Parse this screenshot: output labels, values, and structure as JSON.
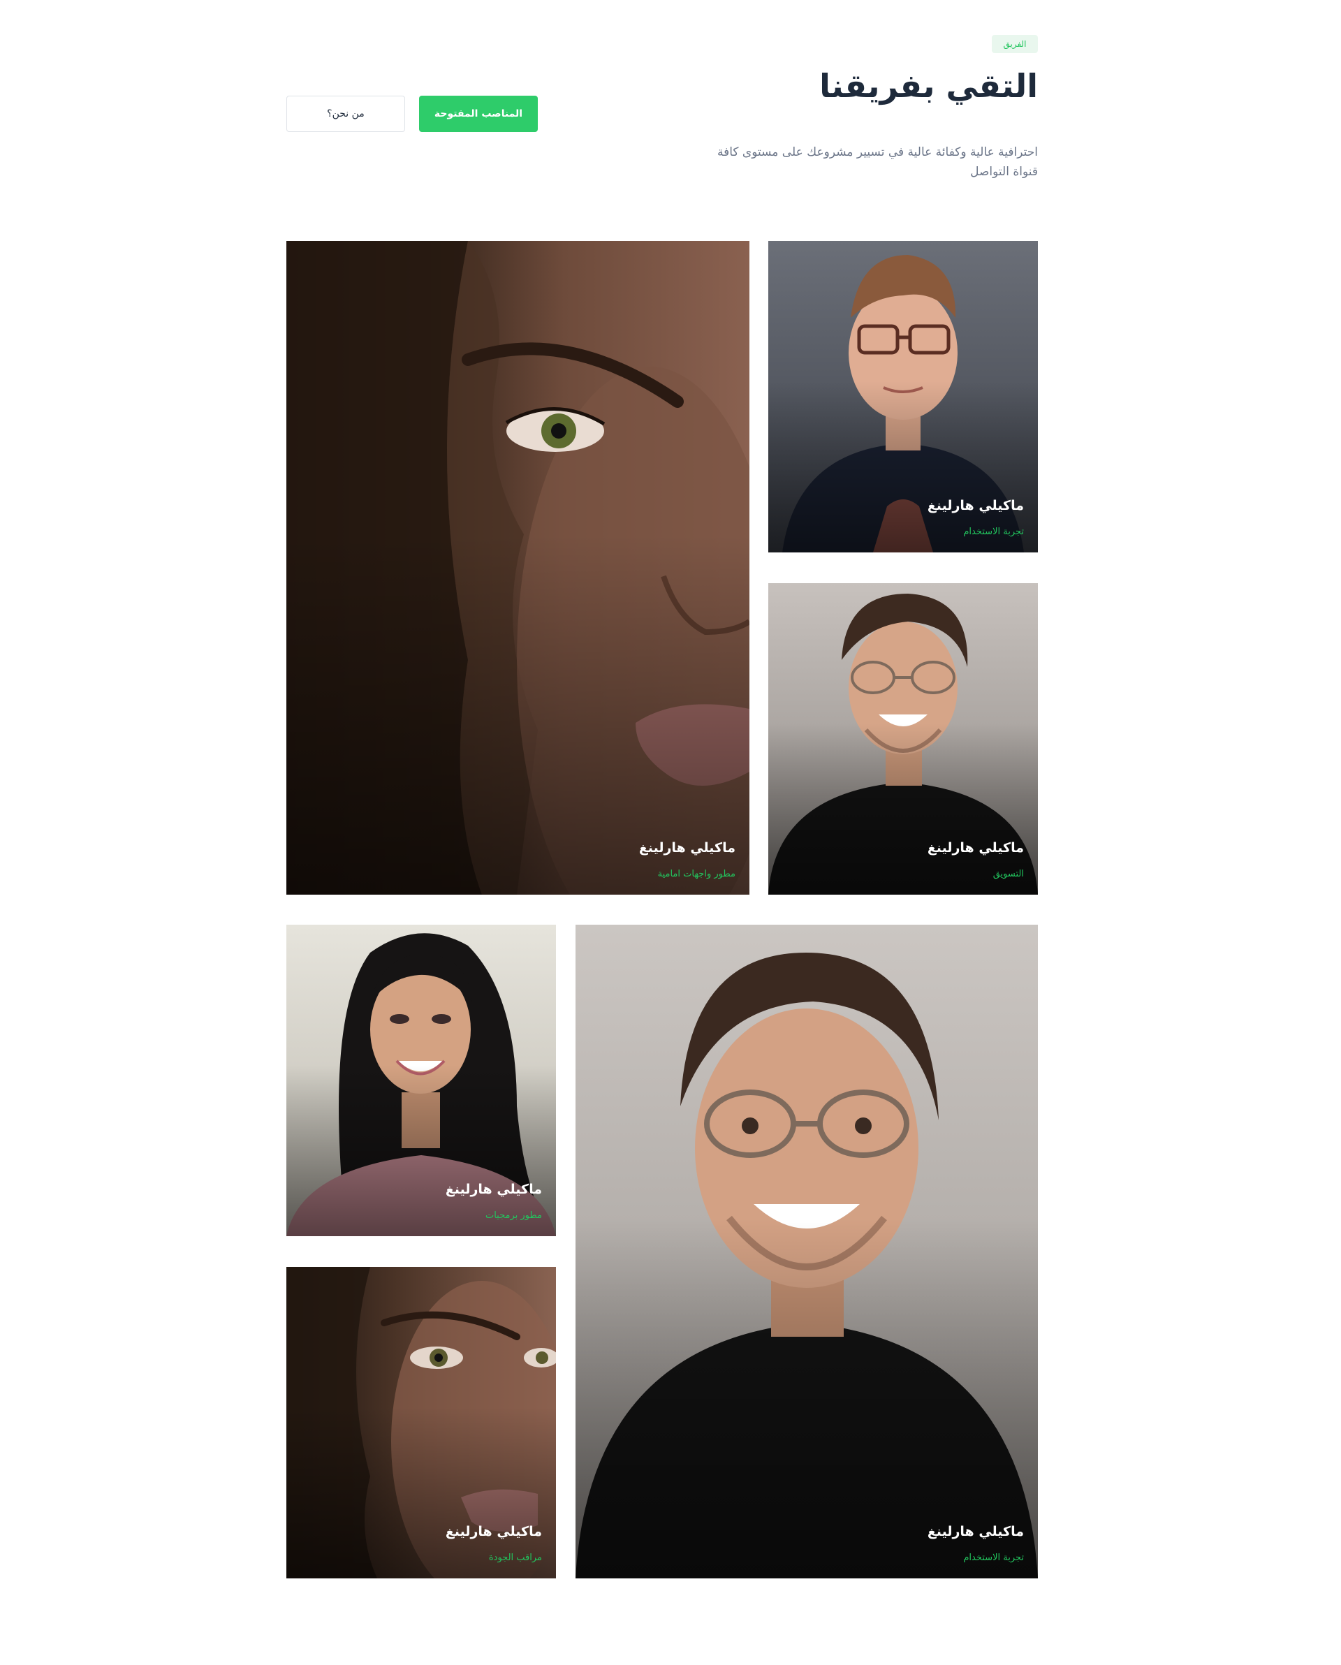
{
  "header": {
    "badge": "الفريق",
    "title": "التقي بفريقنا",
    "subtitle": "احترافية عالية وكفائة عالية في تسيير مشروعك على مستوى كافة قنواة التواصل"
  },
  "actions": {
    "primary_label": "المناصب المفتوحة",
    "secondary_label": "من نحن؟"
  },
  "team": [
    {
      "name": "ماكيلي هارلينغ",
      "role": "مطور واجهات امامية"
    },
    {
      "name": "ماكيلي هارلينغ",
      "role": "تجربة الاستخدام"
    },
    {
      "name": "ماكيلي هارلينغ",
      "role": "التسويق"
    },
    {
      "name": "ماكيلي هارلينغ",
      "role": "مطور برمجيات"
    },
    {
      "name": "ماكيلي هارلينغ",
      "role": "تجربة الاستخدام"
    },
    {
      "name": "ماكيلي هارلينغ",
      "role": "مراقب الجودة"
    }
  ],
  "colors": {
    "accent": "#2ecc6a",
    "role_text": "#22c55e",
    "title_text": "#1e2a3b",
    "subtitle_text": "#6b7588"
  }
}
